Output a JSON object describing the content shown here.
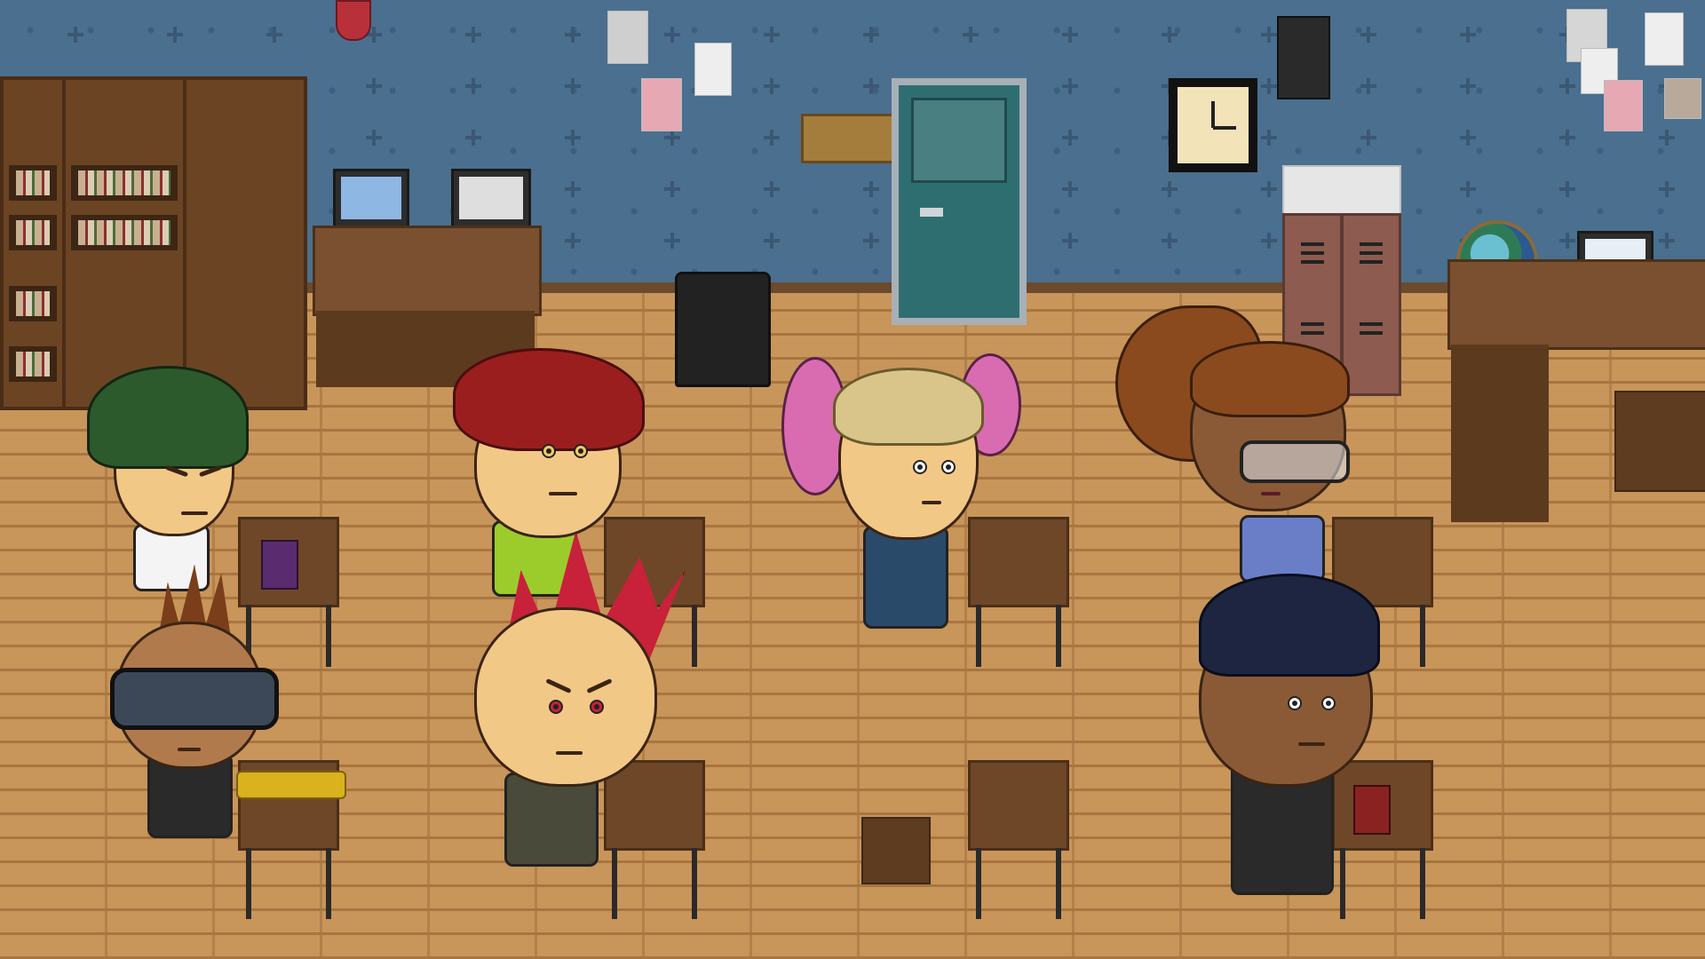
{
  "scene": {
    "name": "classroom",
    "colors": {
      "wall": "#4a6f8f",
      "floor": "#c8955a",
      "door": "#2f6e70"
    }
  },
  "wall_items": {
    "door_sign_text": "",
    "clock_icon": "clock-icon",
    "globe_icon": "globe-icon"
  },
  "students": [
    {
      "id": "beanie",
      "hair": "#2c5a2c",
      "skin": "#f2c887"
    },
    {
      "id": "red-hair",
      "hair": "#9a1e1e",
      "skin": "#f2c887"
    },
    {
      "id": "pigtails",
      "hair": "#d9c58a",
      "skin": "#f2c887"
    },
    {
      "id": "ponytail-glasses",
      "hair": "#8a4a1e",
      "skin": "#8a5a36"
    },
    {
      "id": "mohawk-goggles",
      "hair": "#7a3e1a",
      "skin": "#8a5a36"
    },
    {
      "id": "red-mohawk",
      "hair": "#c8213a",
      "skin": "#f2c887"
    },
    {
      "id": "cap",
      "hair": "#1e2540",
      "skin": "#8a5a36"
    }
  ]
}
